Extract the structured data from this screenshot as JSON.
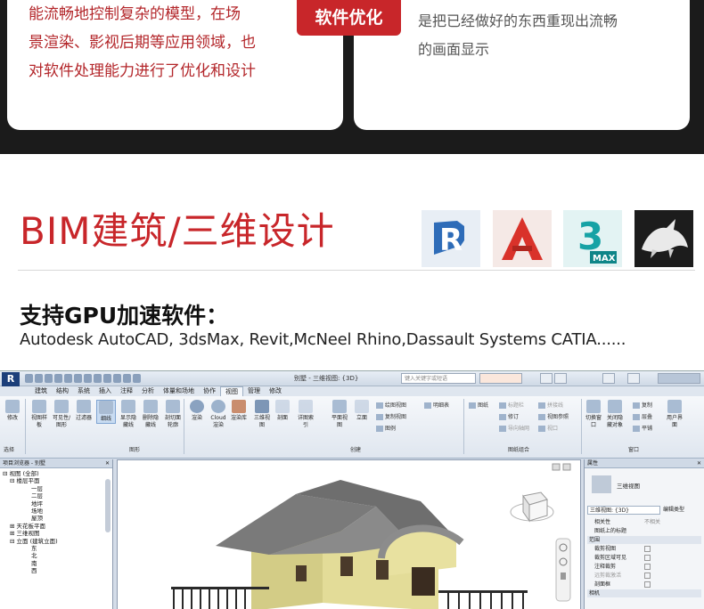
{
  "top_cards": {
    "left_lines": [
      "能流畅地控制复杂的模型，在场",
      "景渲染、影视后期等应用领域，也",
      "对软件处理能力进行了优化和设计"
    ],
    "feature_tag": "软件优化",
    "right_lines": [
      "是把已经做好的东西重现出流畅",
      "的画面显示"
    ]
  },
  "section": {
    "title": "BIM建筑/三维设计",
    "gpu_title": "支持GPU加速软件：",
    "gpu_apps": "Autodesk AutoCAD, 3dsMax, Revit,McNeel Rhino,Dassault Systems CATIA......"
  },
  "app_icons": [
    {
      "name": "revit-icon",
      "letter": "R",
      "color": "#3a7bc8"
    },
    {
      "name": "autocad-icon",
      "letter": "A",
      "color": "#e2352b"
    },
    {
      "name": "3dsmax-icon",
      "letter": "3",
      "sub": "MAX",
      "color": "#1aa3a3"
    },
    {
      "name": "rhino-icon",
      "letter": "",
      "color": "#222222"
    }
  ],
  "revit": {
    "logo": "R",
    "window_title": "别墅 - 三维视图: {3D}",
    "search_placeholder": "键入关键字或短语",
    "tabs": [
      "建筑",
      "结构",
      "系统",
      "插入",
      "注释",
      "分析",
      "体量和场地",
      "协作",
      "视图",
      "管理",
      "修改"
    ],
    "active_tab": "视图",
    "ribbon_buttons": [
      {
        "label": "修改"
      },
      {
        "label": "视图样板"
      },
      {
        "label": "可见性/图形"
      },
      {
        "label": "过滤器"
      },
      {
        "label": "细线"
      },
      {
        "label": "显示隐藏线"
      },
      {
        "label": "删除隐藏线"
      },
      {
        "label": "剖切面轮廓"
      },
      {
        "label": "渲染"
      },
      {
        "label": "Cloud渲染"
      },
      {
        "label": "渲染库"
      },
      {
        "label": "三维视图"
      },
      {
        "label": "剖面"
      },
      {
        "label": "详图索引"
      },
      {
        "label": "平面视图"
      },
      {
        "label": "立面"
      },
      {
        "label": "切换窗口"
      },
      {
        "label": "关闭隐藏对象"
      },
      {
        "label": "用户界面"
      }
    ],
    "ribbon_small": [
      "绘图视图",
      "明细表",
      "复制视图",
      "图例",
      "图纸",
      "标题栏",
      "修订",
      "视图参照",
      "拼接线",
      "导向轴网",
      "视口",
      "复制",
      "层叠",
      "平铺"
    ],
    "groups": [
      "选择",
      "图形",
      "创建",
      "图纸组合",
      "窗口"
    ],
    "browser_title": "项目浏览器 - 别墅",
    "tree": [
      "视图 (全部)",
      "楼层平面",
      "一层",
      "二层",
      "地坪",
      "场地",
      "屋顶",
      "天花板平面",
      "三维视图",
      "立面 (建筑立面)",
      "东",
      "北",
      "南",
      "西"
    ],
    "props_title": "属性",
    "props_type": "三维视图",
    "props_selector": "三维视图: {3D}",
    "props_edit": "编辑类型",
    "props_rows": [
      {
        "label": "相关性",
        "value": "不相关"
      },
      {
        "label": "图纸上的标题",
        "value": ""
      },
      {
        "label": "范围",
        "value": ""
      },
      {
        "label": "裁剪视图",
        "value": ""
      },
      {
        "label": "裁剪区域可见",
        "value": ""
      },
      {
        "label": "注释裁剪",
        "value": ""
      },
      {
        "label": "远剪裁激活",
        "value": ""
      },
      {
        "label": "剖面框",
        "value": ""
      },
      {
        "label": "相机",
        "value": ""
      }
    ]
  }
}
